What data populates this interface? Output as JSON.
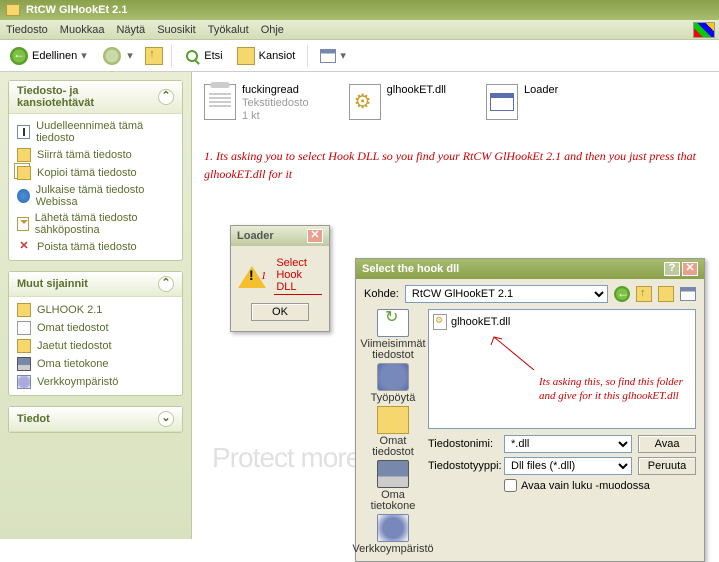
{
  "window": {
    "title": "RtCW GlHookEt 2.1"
  },
  "menu": {
    "items": [
      "Tiedosto",
      "Muokkaa",
      "Näytä",
      "Suosikit",
      "Työkalut",
      "Ohje"
    ]
  },
  "toolbar": {
    "back": "Edellinen",
    "search": "Etsi",
    "folders": "Kansiot"
  },
  "sidebar": {
    "panel1": {
      "title": "Tiedosto- ja kansiotehtävät",
      "tasks": [
        "Uudelleennimeä tämä tiedosto",
        "Siirrä tämä tiedosto",
        "Kopioi tämä tiedosto",
        "Julkaise tämä tiedosto Webissa",
        "Lähetä tämä tiedosto sähköpostina",
        "Poista tämä tiedosto"
      ]
    },
    "panel2": {
      "title": "Muut sijainnit",
      "items": [
        "GLHOOK 2.1",
        "Omat tiedostot",
        "Jaetut tiedostot",
        "Oma tietokone",
        "Verkkoympäristö"
      ]
    },
    "panel3": {
      "title": "Tiedot"
    }
  },
  "files": [
    {
      "name": "fuckingread",
      "type": "Tekstitiedosto",
      "size": "1 kt"
    },
    {
      "name": "glhookET.dll"
    },
    {
      "name": "Loader"
    }
  ],
  "annotation1": "1. Its asking you to select Hook DLL so you find your RtCW GlHookEt 2.1 and then you just press that glhookET.dll for it",
  "loader": {
    "title": "Loader",
    "msg": "1",
    "link": "Select Hook DLL",
    "ok": "OK"
  },
  "opendlg": {
    "title": "Select the hook dll",
    "lookin_label": "Kohde:",
    "lookin_value": "RtCW GlHookET 2.1",
    "file": "glhookET.dll",
    "places": [
      "Viimeisimmät tiedostot",
      "Työpöytä",
      "Omat tiedostot",
      "Oma tietokone",
      "Verkkoympäristö"
    ],
    "fn_label": "Tiedostonimi:",
    "fn_value": "*.dll",
    "ft_label": "Tiedostotyyppi:",
    "ft_value": "Dll files (*.dll)",
    "open": "Avaa",
    "cancel": "Peruuta",
    "readonly": "Avaa vain luku -muodossa"
  },
  "annotation2": "Its asking this, so find this folder and give for it this glhookET.dll",
  "watermark": "Protect more of your memories for less!"
}
